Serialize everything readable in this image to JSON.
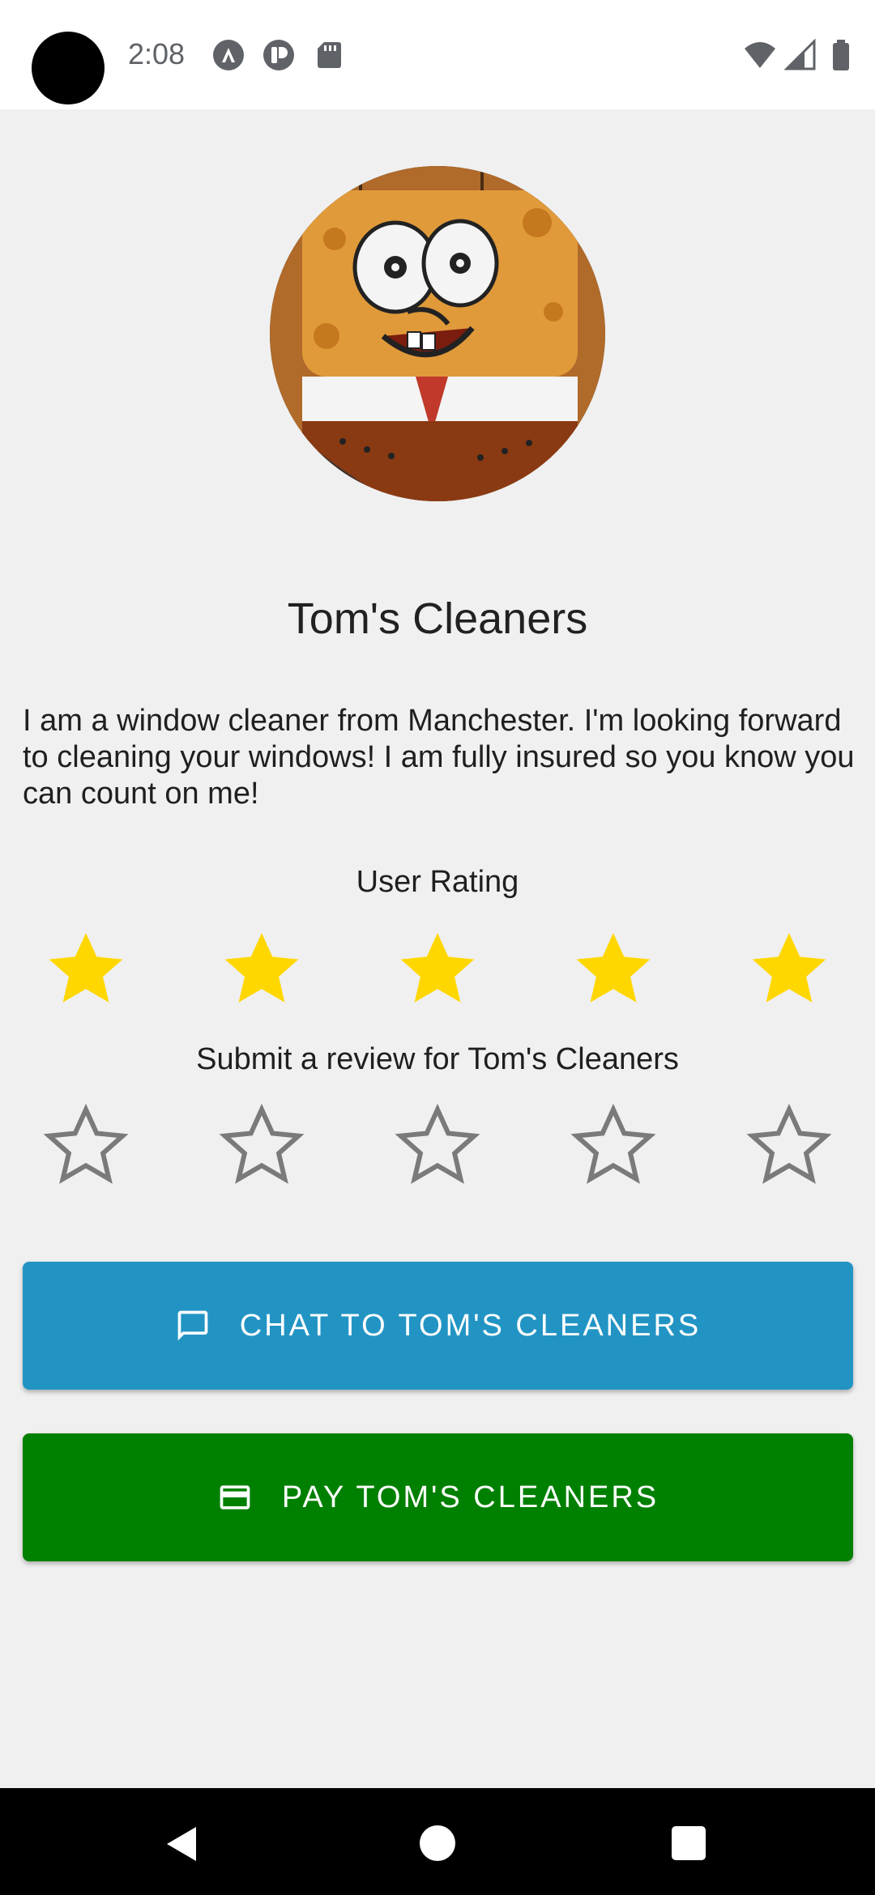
{
  "status_bar": {
    "time": "2:08",
    "left_icons": [
      "a-notification-icon",
      "p-notification-icon",
      "sd-card-icon"
    ],
    "right_icons": [
      "wifi-icon",
      "cell-signal-icon",
      "battery-icon"
    ]
  },
  "profile": {
    "name": "Tom's Cleaners",
    "description": "I am a window cleaner from Manchester. I'm looking forward to cleaning your windows! I am fully insured so you know you can count on me!",
    "avatar_icon": "profile-avatar-image"
  },
  "rating": {
    "label": "User Rating",
    "value": 5,
    "max": 5,
    "color": "#FFD700"
  },
  "review": {
    "label": "Submit a review for Tom's Cleaners",
    "value": 0,
    "max": 5,
    "empty_color": "#7a7a7a"
  },
  "buttons": {
    "chat_label": "CHAT TO TOM'S CLEANERS",
    "chat_icon": "chat-bubble-icon",
    "chat_color": "#2294C4",
    "pay_label": "PAY TOM'S CLEANERS",
    "pay_icon": "credit-card-icon",
    "pay_color": "#008000"
  },
  "nav_bar": {
    "icons": [
      "back-icon",
      "home-icon",
      "recents-icon"
    ]
  }
}
